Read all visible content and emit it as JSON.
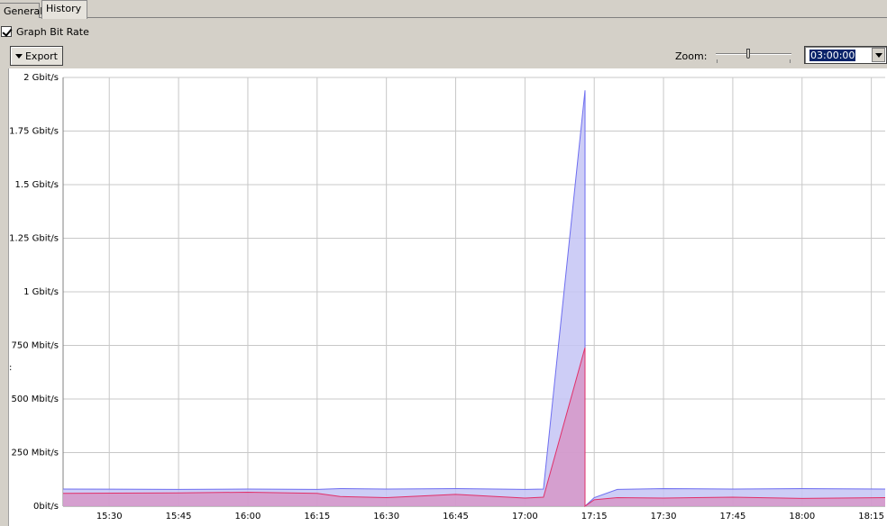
{
  "tabs": [
    {
      "label": "General",
      "active": false
    },
    {
      "label": "History",
      "active": true
    }
  ],
  "graph_bit_rate": {
    "label": "Graph Bit Rate",
    "checked": true
  },
  "export": {
    "label": "Export"
  },
  "zoom": {
    "label": "Zoom:",
    "value": "03:00:00",
    "slider_position": 0.42
  },
  "side_mark": ":",
  "colors": {
    "upstream": "#6e6ef0",
    "upstream_fill": "#c4c4f5",
    "downstream": "#e0306a",
    "downstream_fill": "#d98cbf",
    "grid": "#c8c8c8"
  },
  "chart_data": {
    "type": "area",
    "title": "",
    "xlabel": "",
    "ylabel": "",
    "x_ticks": [
      "15:30",
      "15:45",
      "16:00",
      "16:15",
      "16:30",
      "16:45",
      "17:00",
      "17:15",
      "17:30",
      "17:45",
      "18:00",
      "18:15"
    ],
    "y_ticks": [
      "0bit/s",
      "250 Mbit/s",
      "500 Mbit/s",
      "750 Mbit/s",
      "1 Gbit/s",
      "1.25 Gbit/s",
      "1.5 Gbit/s",
      "1.75 Gbit/s",
      "2 Gbit/s"
    ],
    "xlim": [
      "15:20",
      "18:18"
    ],
    "ylim_mbps": [
      0,
      2000
    ],
    "grid": true,
    "series": [
      {
        "x": [
          "15:20",
          "15:45",
          "16:00",
          "16:15",
          "16:20",
          "16:30",
          "16:45",
          "17:00",
          "17:04",
          "17:13",
          "17:13",
          "17:15",
          "17:20",
          "17:30",
          "17:45",
          "18:00",
          "18:18"
        ],
        "y_mbps": [
          80,
          78,
          80,
          78,
          82,
          80,
          82,
          78,
          80,
          1940,
          0,
          40,
          78,
          82,
          80,
          82,
          80
        ]
      },
      {
        "x": [
          "15:20",
          "15:45",
          "16:00",
          "16:15",
          "16:20",
          "16:30",
          "16:45",
          "17:00",
          "17:04",
          "17:13",
          "17:13",
          "17:15",
          "17:20",
          "17:30",
          "17:45",
          "18:00",
          "18:18"
        ],
        "y_mbps": [
          60,
          62,
          65,
          60,
          45,
          40,
          55,
          38,
          42,
          740,
          0,
          30,
          40,
          38,
          42,
          36,
          40
        ]
      }
    ]
  }
}
